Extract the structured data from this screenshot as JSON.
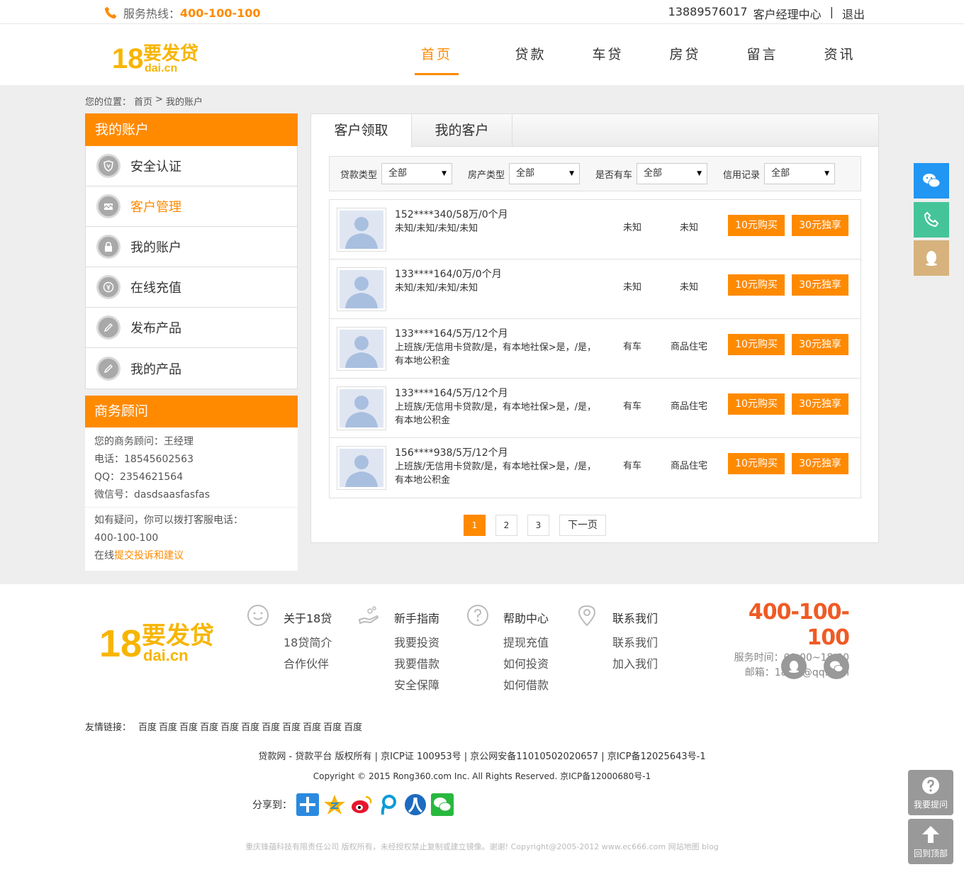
{
  "topbar": {
    "hotline_label": "服务热线：",
    "hotline_number": "400-100-100",
    "phone": "13889576017",
    "center": "客户经理中心",
    "sep": "|",
    "logout": "退出"
  },
  "nav": [
    {
      "label": "首页",
      "active": true
    },
    {
      "label": "贷款"
    },
    {
      "label": "车贷"
    },
    {
      "label": "房贷"
    },
    {
      "label": "留言"
    },
    {
      "label": "资讯"
    }
  ],
  "breadcrumb": {
    "prefix": "您的位置：",
    "home": "首页",
    "sep": ">",
    "current": "我的账户"
  },
  "sidebar": {
    "title": "我的账户",
    "items": [
      {
        "label": "安全认证",
        "icon": "shield-icon"
      },
      {
        "label": "客户管理",
        "icon": "customer-icon",
        "active": true
      },
      {
        "label": "我的账户",
        "icon": "lock-icon"
      },
      {
        "label": "在线充值",
        "icon": "coin-icon"
      },
      {
        "label": "发布产品",
        "icon": "pencil-icon"
      },
      {
        "label": "我的产品",
        "icon": "pencil-icon"
      }
    ]
  },
  "advisor": {
    "title": "商务顾问",
    "name": "您的商务顾问：王经理",
    "tel": "电话：18545602563",
    "qq": "QQ：2354621564",
    "wechat": "微信号：dasdsaasfasfas",
    "question": "如有疑问，你可以拨打客服电话：",
    "hotline": "400-100-100",
    "online": "在线",
    "complaint": "提交投诉和建议"
  },
  "tabs": [
    {
      "label": "客户领取",
      "active": true
    },
    {
      "label": "我的客户"
    }
  ],
  "filters": [
    {
      "label": "贷款类型",
      "value": "全部"
    },
    {
      "label": "房产类型",
      "value": "全部"
    },
    {
      "label": "是否有车",
      "value": "全部"
    },
    {
      "label": "信用记录",
      "value": "全部"
    }
  ],
  "customers": [
    {
      "title": "152****340/58万/0个月",
      "desc": "未知/未知/未知/未知",
      "car": "未知",
      "house": "未知",
      "buy": "10元购买",
      "exclusive": "30元独享"
    },
    {
      "title": "133****164/0万/0个月",
      "desc": "未知/未知/未知/未知",
      "car": "未知",
      "house": "未知",
      "buy": "10元购买",
      "exclusive": "30元独享"
    },
    {
      "title": "133****164/5万/12个月",
      "desc": "上班族/无信用卡贷款/是，有本地社保>是，/是，有本地公积金",
      "car": "有车",
      "house": "商品住宅",
      "buy": "10元购买",
      "exclusive": "30元独享"
    },
    {
      "title": "133****164/5万/12个月",
      "desc": "上班族/无信用卡贷款/是，有本地社保>是，/是，有本地公积金",
      "car": "有车",
      "house": "商品住宅",
      "buy": "10元购买",
      "exclusive": "30元独享"
    },
    {
      "title": "156****938/5万/12个月",
      "desc": "上班族/无信用卡贷款/是，有本地社保>是，/是，有本地公积金",
      "car": "有车",
      "house": "商品住宅",
      "buy": "10元购买",
      "exclusive": "30元独享"
    }
  ],
  "pager": {
    "pages": [
      "1",
      "2",
      "3"
    ],
    "current": "1",
    "next": "下一页"
  },
  "footer": {
    "columns": [
      {
        "head": "关于18贷",
        "icon": "smile-icon",
        "links": [
          "18贷简介",
          "合作伙伴"
        ]
      },
      {
        "head": "新手指南",
        "icon": "hand-icon",
        "links": [
          "我要投资",
          "我要借款",
          "安全保障"
        ]
      },
      {
        "head": "帮助中心",
        "icon": "question-icon",
        "links": [
          "提现充值",
          "如何投资",
          "如何借款"
        ]
      },
      {
        "head": "联系我们",
        "icon": "location-icon",
        "links": [
          "联系我们",
          "加入我们"
        ]
      }
    ],
    "contact_number": "400-100-100",
    "hours": "服务时间：09:00~18:00",
    "email": "邮箱：18dai@qq.com",
    "friend_label": "友情链接：",
    "friend_links": [
      "百度",
      "百度",
      "百度",
      "百度",
      "百度",
      "百度",
      "百度",
      "百度",
      "百度",
      "百度",
      "百度"
    ],
    "copy1": "贷款网 - 贷款平台 版权所有 | 京ICP证 100953号 | 京公网安备11010502020657 | 京ICP备12025643号-1",
    "copy2": "Copyright © 2015 Rong360.com Inc. All Rights Reserved. 京ICP备12000680号-1",
    "share_label": "分享到：",
    "copy3": "重庆锋蕴科技有限责任公司 版权所有，未经授权禁止复制或建立镜像。谢谢! Copyright@2005-2012 www.ec666.com 网站地图 blog"
  },
  "logo_text": {
    "number": "18",
    "main": "要发贷",
    "sub": "dai.cn"
  },
  "side_buttons": {
    "ask": "我要提问",
    "top": "回到顶部"
  },
  "colors": {
    "accent": "#ff8a00",
    "wechat": "#2196f3",
    "phone": "#45c49a",
    "qq": "#d7b27d"
  }
}
